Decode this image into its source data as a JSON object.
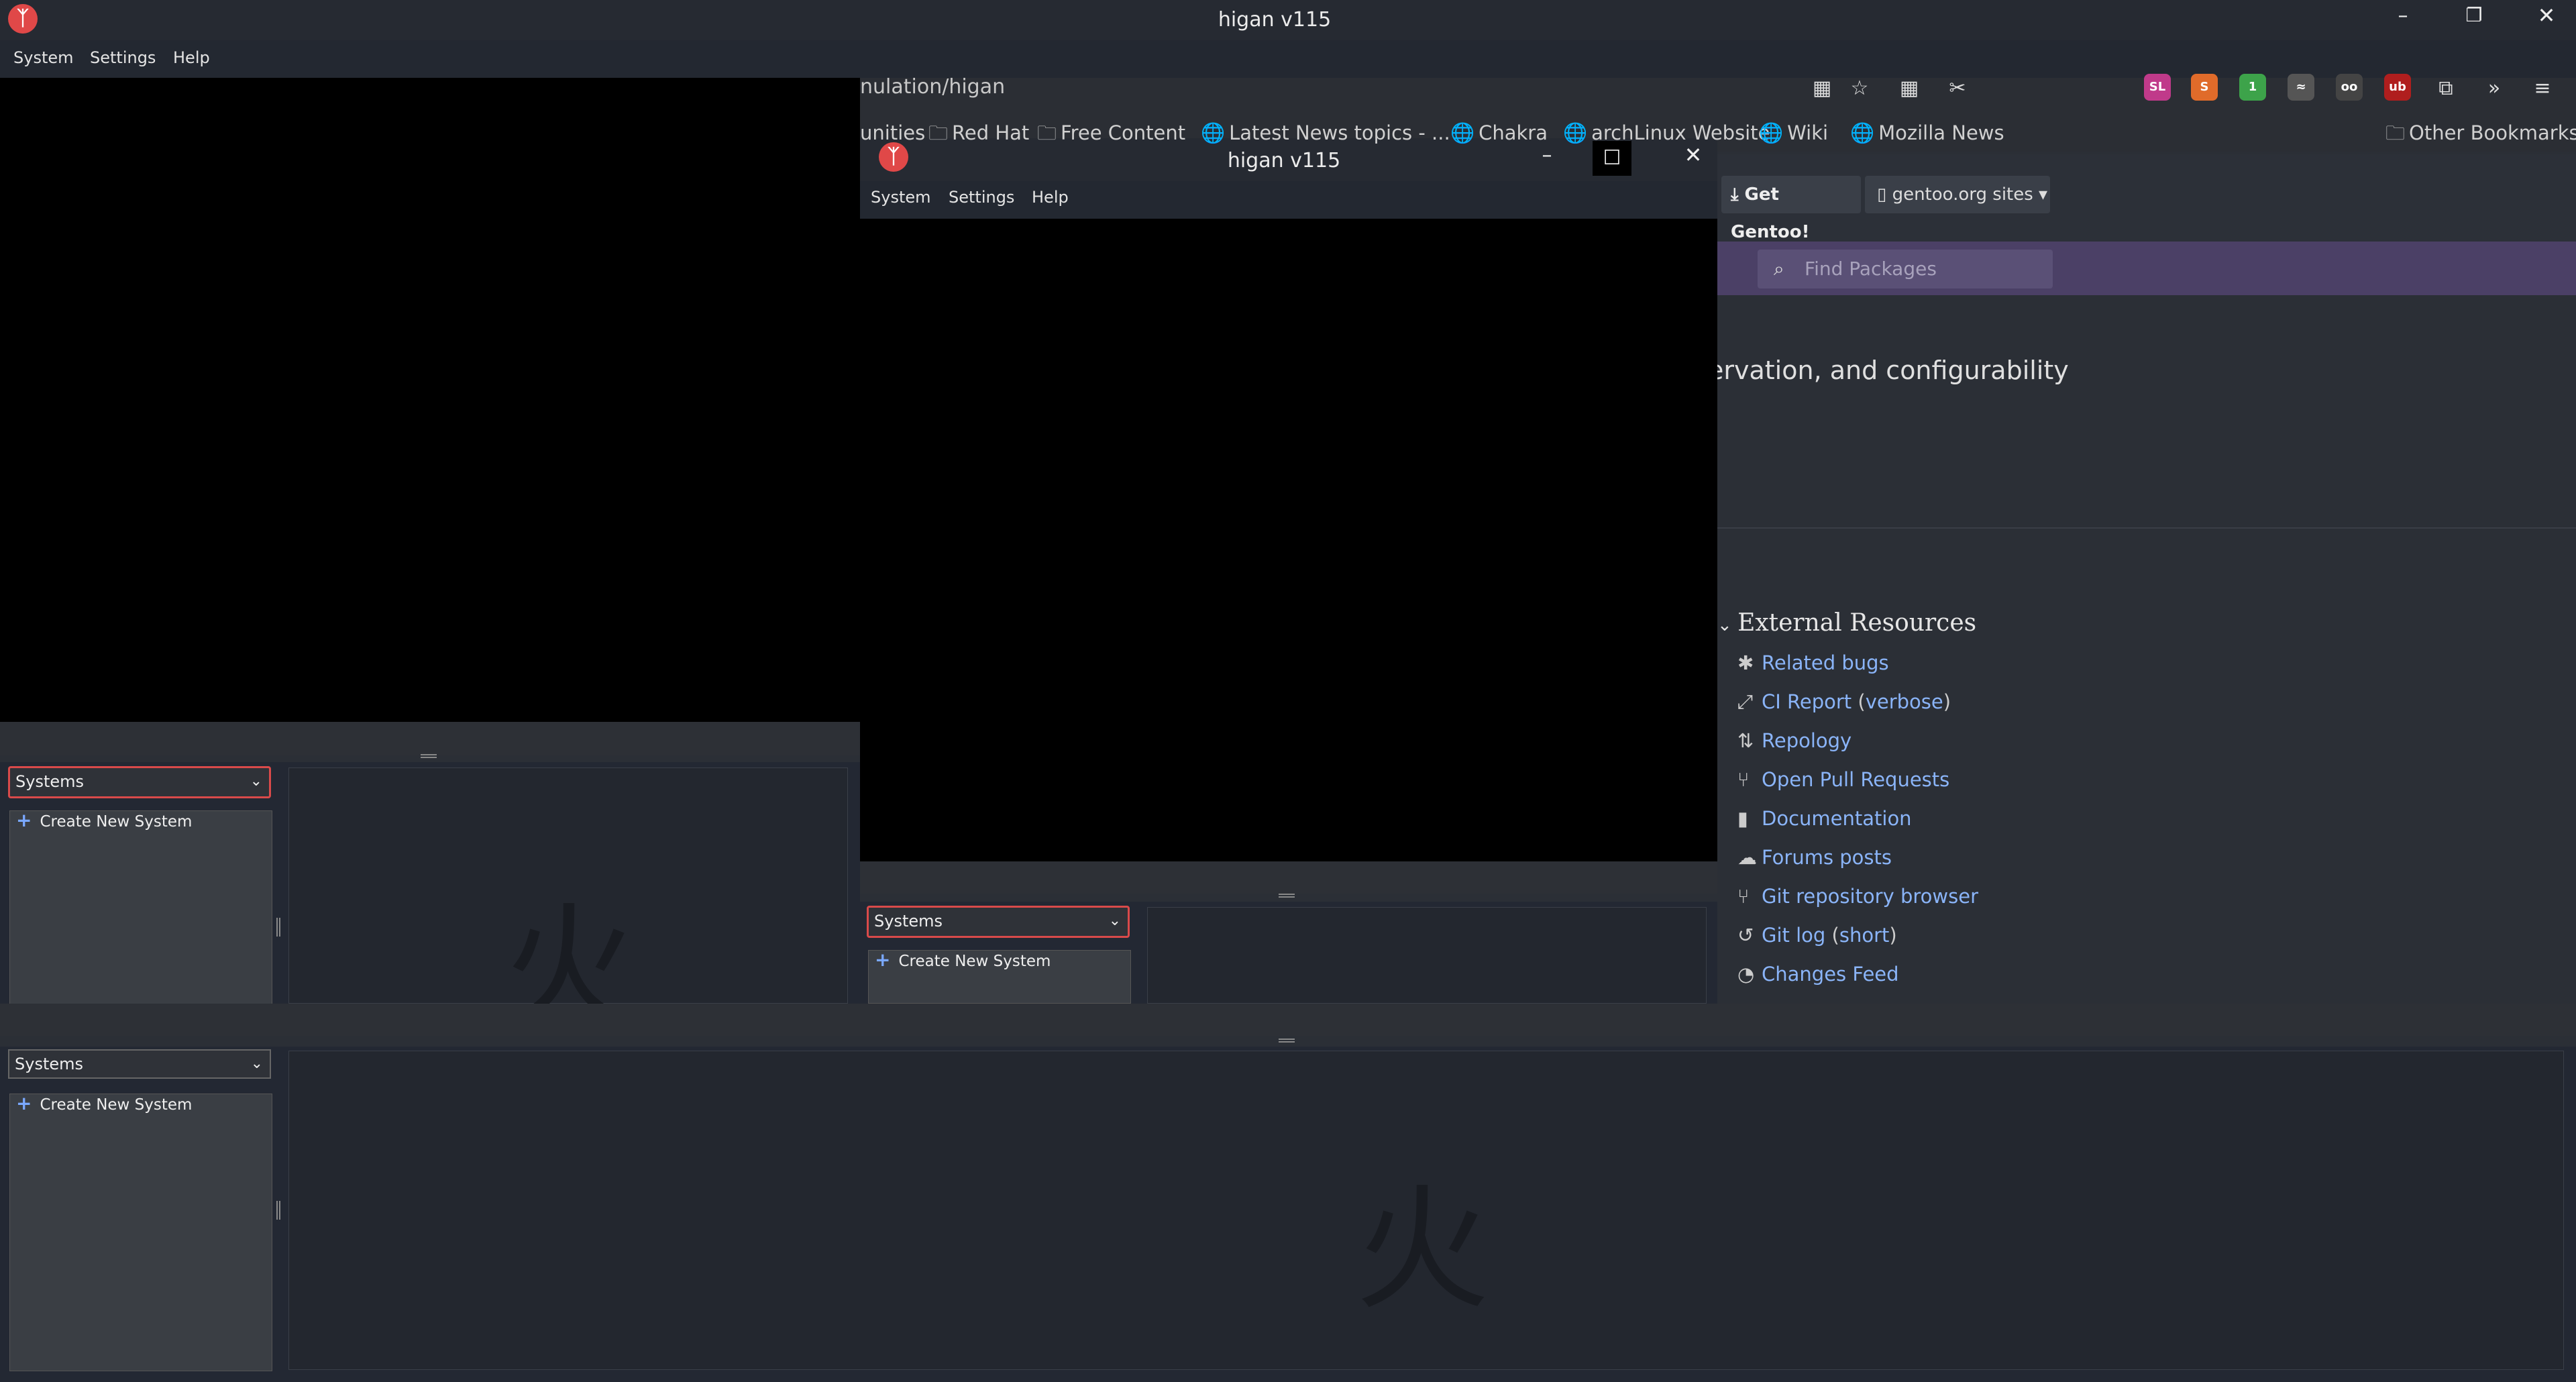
{
  "main_window": {
    "title": "higan v115",
    "menu": [
      "System",
      "Settings",
      "Help"
    ]
  },
  "browser": {
    "url_fragment": "nulation/higan",
    "bookmarks": [
      {
        "label": "unities",
        "icon": ""
      },
      {
        "label": "Red Hat",
        "icon": "folder-icon"
      },
      {
        "label": "Free Content",
        "icon": "folder-icon"
      },
      {
        "label": "Latest News topics - ...",
        "icon": "globe-icon"
      },
      {
        "label": "Chakra",
        "icon": "globe-icon"
      },
      {
        "label": "archLinux Website",
        "icon": "globe-icon"
      },
      {
        "label": "Wiki",
        "icon": "globe-icon"
      },
      {
        "label": "Mozilla News",
        "icon": "globe-icon"
      }
    ],
    "other_bookmarks": "Other Bookmarks",
    "extensions": [
      {
        "label": "SL",
        "color": "#c03a8a"
      },
      {
        "label": "S",
        "color": "#e06b2a"
      },
      {
        "label": "1",
        "color": "#3da34a"
      },
      {
        "label": "≈",
        "color": "#555"
      },
      {
        "label": "oo",
        "color": "#444"
      },
      {
        "label": "ub",
        "color": "#b01e1e"
      }
    ]
  },
  "gentoo": {
    "get_gentoo": "Get Gentoo!",
    "sites": "gentoo.org sites",
    "find_placeholder": "Find Packages",
    "tagline": "ervation, and configurability",
    "external_title": "External Resources",
    "resources": [
      {
        "label": "Related bugs",
        "icon": "bug-icon"
      },
      {
        "label": "CI Report",
        "extra": "verbose",
        "icon": "ci-icon"
      },
      {
        "label": "Repology",
        "icon": "sort-icon"
      },
      {
        "label": "Open Pull Requests",
        "icon": "pull-request-icon"
      },
      {
        "label": "Documentation",
        "icon": "book-icon"
      },
      {
        "label": "Forums posts",
        "icon": "chat-icon"
      },
      {
        "label": "Git repository browser",
        "icon": "git-branch-icon"
      },
      {
        "label": "Git log",
        "extra": "short",
        "icon": "history-icon"
      },
      {
        "label": "Changes Feed",
        "icon": "rss-icon"
      }
    ]
  },
  "child_window": {
    "title": "higan v115",
    "menu": [
      "System",
      "Settings",
      "Help"
    ]
  },
  "systems_panel": {
    "select_value": "Systems",
    "create_label": "Create New System",
    "kanji": "火"
  },
  "colors": {
    "accent_red": "#e04848",
    "link_blue": "#8ab4f8",
    "gentoo_purple": "#4b4066"
  }
}
